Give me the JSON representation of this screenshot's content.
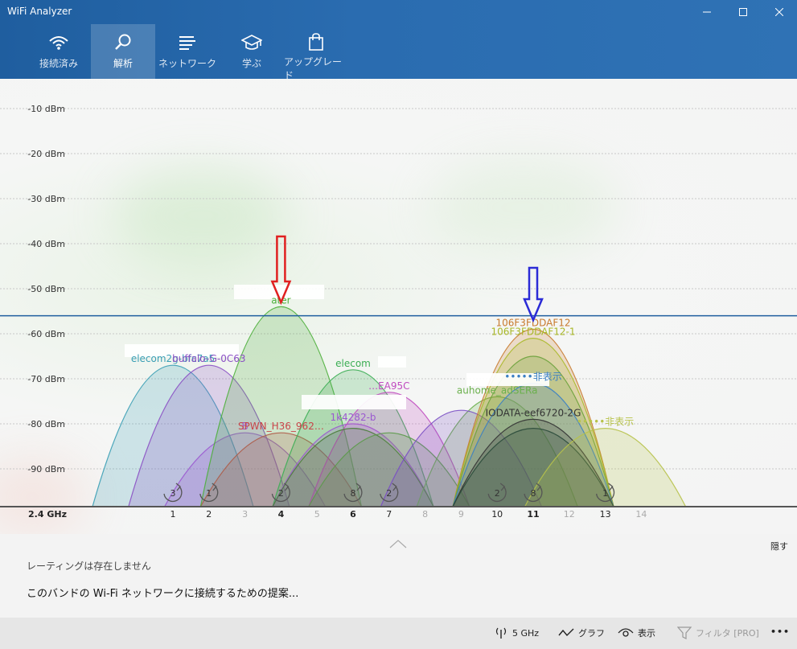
{
  "window": {
    "title": "WiFi Analyzer"
  },
  "nav": {
    "tabs": [
      {
        "label": "接続済み",
        "icon": "wifi-icon"
      },
      {
        "label": "解析",
        "icon": "analyze-icon",
        "active": true
      },
      {
        "label": "ネットワーク",
        "icon": "network-list-icon"
      },
      {
        "label": "学ぶ",
        "icon": "graduation-cap-icon"
      },
      {
        "label": "アップグレード",
        "icon": "shopping-bag-icon"
      }
    ]
  },
  "chart_data": {
    "type": "area",
    "title": "",
    "xlabel": "2.4 GHz",
    "ylabel": "",
    "y_unit": "dBm",
    "ylim": [
      -100,
      -5
    ],
    "y_ticks": [
      "-10 dBm",
      "-20 dBm",
      "-30 dBm",
      "-40 dBm",
      "-50 dBm",
      "-60 dBm",
      "-70 dBm",
      "-80 dBm",
      "-90 dBm"
    ],
    "x_ticks": [
      {
        "ch": 1,
        "label": "1",
        "bold": false,
        "faded": false
      },
      {
        "ch": 2,
        "label": "2",
        "bold": false,
        "faded": false
      },
      {
        "ch": 3,
        "label": "3",
        "bold": false,
        "faded": true
      },
      {
        "ch": 4,
        "label": "4",
        "bold": true,
        "faded": false
      },
      {
        "ch": 5,
        "label": "5",
        "bold": false,
        "faded": true
      },
      {
        "ch": 6,
        "label": "6",
        "bold": true,
        "faded": false
      },
      {
        "ch": 7,
        "label": "7",
        "bold": false,
        "faded": false
      },
      {
        "ch": 8,
        "label": "8",
        "bold": false,
        "faded": true
      },
      {
        "ch": 9,
        "label": "9",
        "bold": false,
        "faded": true
      },
      {
        "ch": 10,
        "label": "10",
        "bold": false,
        "faded": false
      },
      {
        "ch": 11,
        "label": "11",
        "bold": true,
        "faded": false
      },
      {
        "ch": 12,
        "label": "12",
        "bold": false,
        "faded": true
      },
      {
        "ch": 13,
        "label": "13",
        "bold": false,
        "faded": false
      },
      {
        "ch": 14,
        "label": "14",
        "bold": false,
        "faded": true
      }
    ],
    "threshold_dbm": -56,
    "grid": true,
    "legend": "none",
    "series": [
      {
        "name": "elecom2g-bfc7a5",
        "channel": 1,
        "peak": -67,
        "color": "#3a9fb5"
      },
      {
        "name": "buffalo-G-0C63",
        "channel": 2,
        "peak": -67,
        "color": "#8a4fc4"
      },
      {
        "name": "B",
        "channel": 3,
        "peak": -82,
        "color": "#9b59d0"
      },
      {
        "name": "SPWN_H36_962…",
        "channel": 4,
        "peak": -82,
        "color": "#c9444a"
      },
      {
        "name": "ater",
        "channel": 4,
        "peak": -54,
        "color": "#4caf3b"
      },
      {
        "name": "elecom",
        "channel": 6,
        "peak": -68,
        "color": "#3cae54"
      },
      {
        "name": "1k4282-b",
        "channel": 6,
        "peak": -80,
        "color": "#9b59d0"
      },
      {
        "name": "…EA95C",
        "channel": 7,
        "peak": -73,
        "color": "#c04bc0"
      },
      {
        "name": "",
        "channel": 6,
        "peak": -81,
        "color": "#4a7c3a"
      },
      {
        "name": "",
        "channel": 7,
        "peak": -82,
        "color": "#5a9a48"
      },
      {
        "name": "auhome_adSERa",
        "channel": 10,
        "peak": -74,
        "color": "#6ab04c"
      },
      {
        "name": "",
        "channel": 9,
        "peak": -77,
        "color": "#7a4fc4"
      },
      {
        "name": "106F3FDDAF12",
        "channel": 11,
        "peak": -59,
        "color": "#c87a2e"
      },
      {
        "name": "106F3FDDAF12-1",
        "channel": 11,
        "peak": -61,
        "color": "#a9b828"
      },
      {
        "name": "",
        "channel": 11,
        "peak": -65,
        "color": "#6aa13a"
      },
      {
        "name": "•••••非表示",
        "channel": 11,
        "peak": -71,
        "color": "#3a7fc4"
      },
      {
        "name": "IODATA-eef6720-2G",
        "channel": 11,
        "peak": -79,
        "color": "#333333"
      },
      {
        "name": "",
        "channel": 11,
        "peak": -81,
        "color": "#2a4a3a"
      },
      {
        "name": "•••••非表示",
        "channel": 13,
        "peak": -81,
        "color": "#b7c24a"
      }
    ],
    "markers": [
      {
        "channel": 1,
        "count": 3
      },
      {
        "channel": 2,
        "count": 1
      },
      {
        "channel": 4,
        "count": 2
      },
      {
        "channel": 6,
        "count": 8
      },
      {
        "channel": 7,
        "count": 2
      },
      {
        "channel": 10,
        "count": 2
      },
      {
        "channel": 11,
        "count": 8
      },
      {
        "channel": 13,
        "count": 1
      }
    ],
    "arrows": [
      {
        "channel": 4,
        "color": "#e02020"
      },
      {
        "channel": 11,
        "color": "#2b2bd6"
      }
    ]
  },
  "bottom": {
    "rating": "レーティングは存在しません",
    "suggestion": "このバンドの Wi-Fi ネットワークに接続するための提案...",
    "hide": "隠す"
  },
  "bottombar": {
    "band": "5 GHz",
    "graph": "グラフ",
    "view": "表示",
    "filter": "フィルタ [PRO]",
    "more": "•••"
  }
}
